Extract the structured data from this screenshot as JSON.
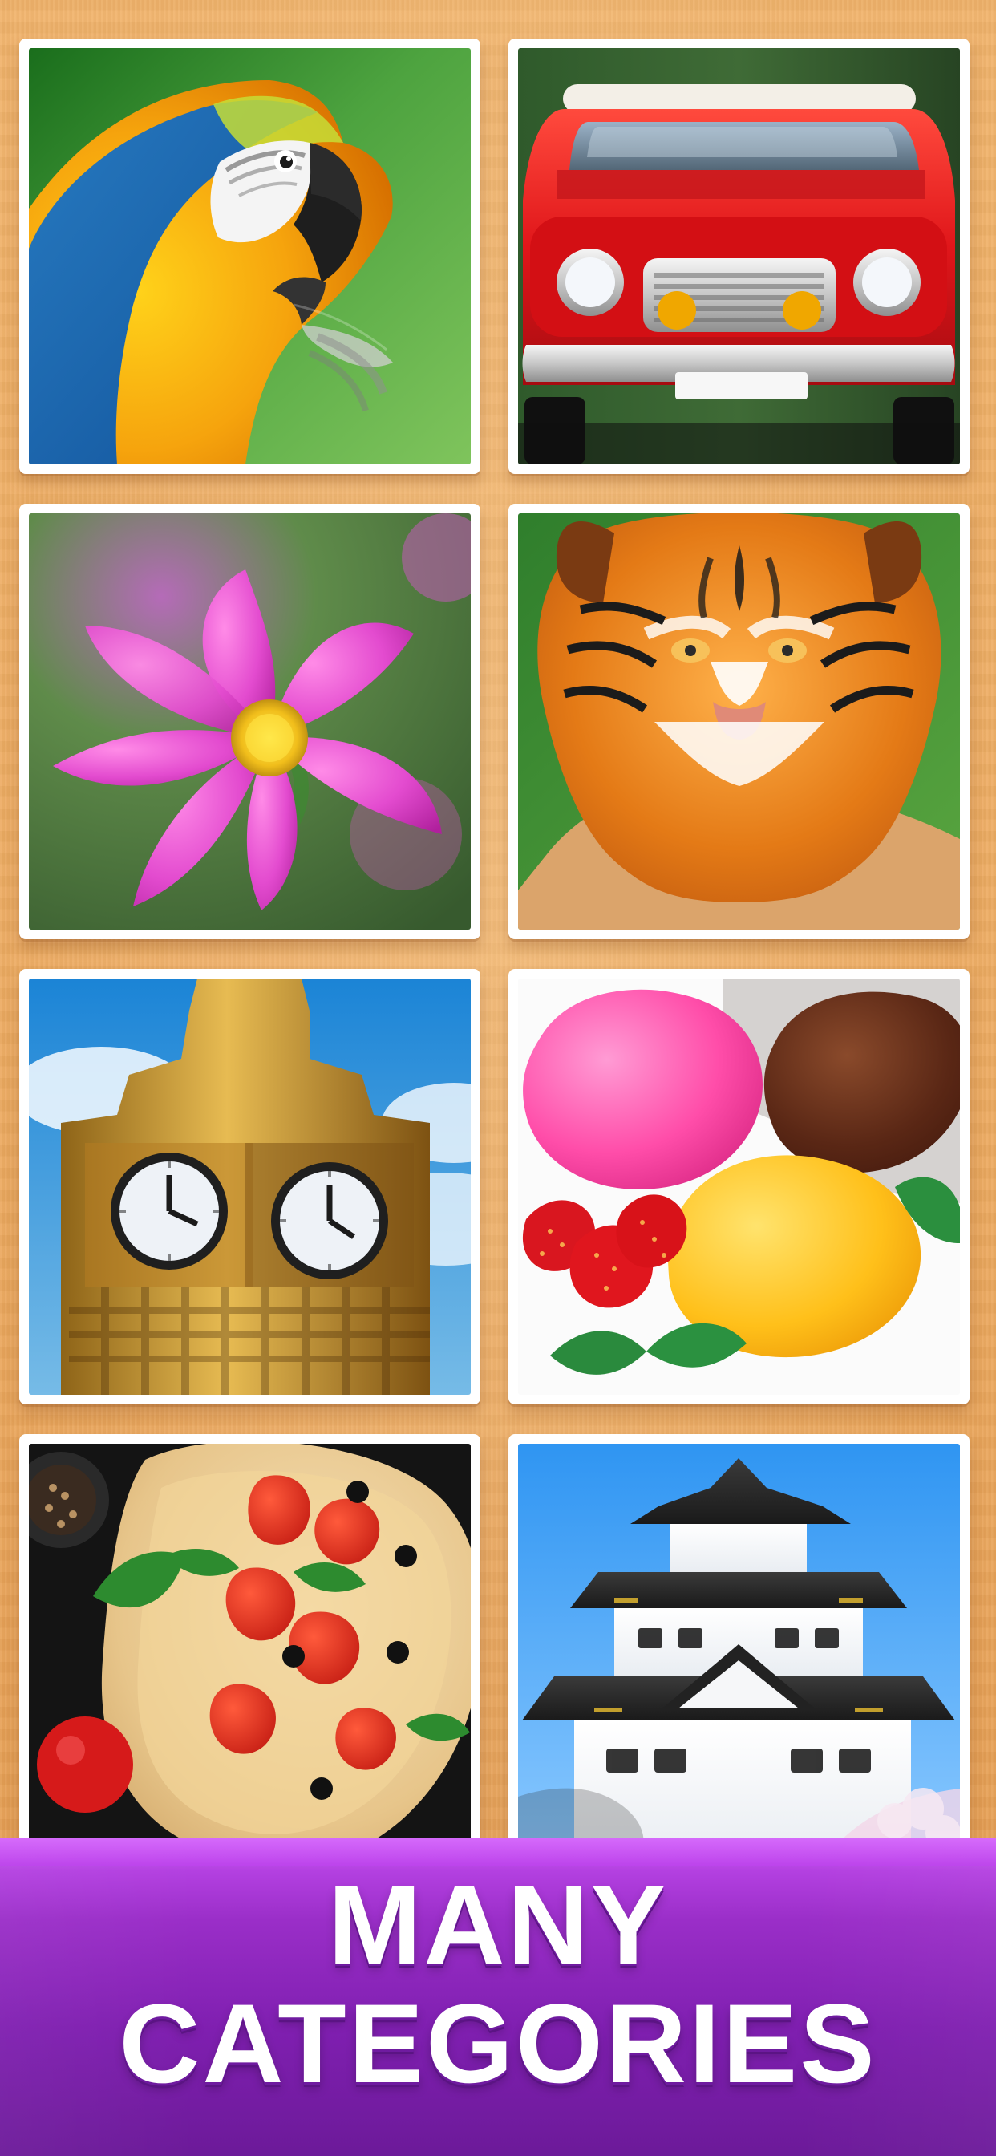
{
  "banner": {
    "line1": "MANY",
    "line2": "CATEGORIES"
  },
  "colors": {
    "wood": "#eca95f",
    "banner_purple": "#8f28bf",
    "card_border": "#ffffff",
    "text": "#ffffff"
  }
}
